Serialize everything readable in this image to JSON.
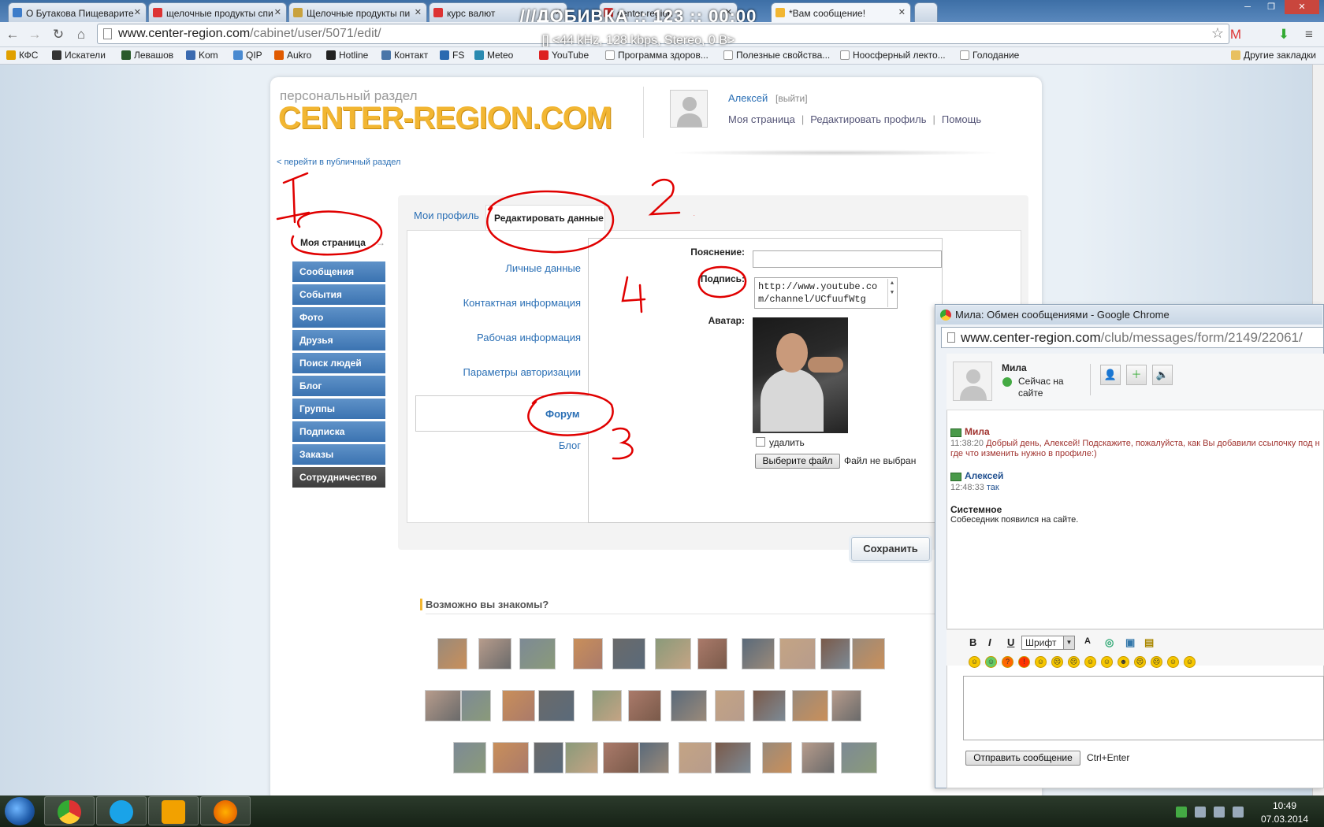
{
  "browser": {
    "tabs": [
      {
        "label": "О Бутакова Пищеварите"
      },
      {
        "label": "щелочные продукты спи"
      },
      {
        "label": "Щелочные продукты пи"
      },
      {
        "label": "курс валют"
      },
      {
        "label": "center-region"
      },
      {
        "label": "*Вам сообщение!"
      }
    ],
    "overlay_title": "///ДОБИВКА :: 123 :: 00:00",
    "overlay_sub": "[] <44 kHz, 128 kbps, Stereo, 0 B>",
    "url_host": "www.center-region.com",
    "url_path": "/cabinet/user/5071/edit/",
    "bookmarks": [
      "КФС",
      "Искатели",
      "Левашов",
      "Kom",
      "QIP",
      "Aukro",
      "Hotline",
      "Контакт",
      "FS",
      "Meteo",
      "YouTube",
      "Программа здоров...",
      "Полезные свойства...",
      "Ноосферный лекто...",
      "Голодание"
    ],
    "other_bookmarks": "Другие закладки"
  },
  "site": {
    "subtitle": "персональный раздел",
    "brand": "CENTER-REGION.COM",
    "user_name": "Алексей",
    "logout": "[выйти]",
    "nav": {
      "my_page": "Моя страница",
      "edit_profile": "Редактировать профиль",
      "help": "Помощь"
    },
    "public_link": "< перейти в публичный раздел"
  },
  "menu": {
    "my_page": "Моя страница",
    "items": [
      "Сообщения",
      "События",
      "Фото",
      "Друзья",
      "Поиск людей",
      "Блог",
      "Группы",
      "Подписка",
      "Заказы",
      "Сотрудничество"
    ]
  },
  "profile": {
    "tab_profile": "Мои профиль",
    "tab_edit": "Редактировать данные",
    "sections": [
      "Личные данные",
      "Контактная информация",
      "Рабочая информация",
      "Параметры авторизации",
      "Форум",
      "Блог"
    ],
    "labels": {
      "explanation": "Пояснение:",
      "signature": "Подпись:",
      "avatar": "Аватар:"
    },
    "explanation_value": "",
    "signature_value": "http://www.youtube.com/channel/UCfuufWtg",
    "delete_label": "удалить",
    "file_button": "Выберите файл",
    "file_none": "Файл не выбран",
    "save": "Сохранить"
  },
  "friends": {
    "title": "Возможно вы знакомы?"
  },
  "annotations": [
    "1",
    "2",
    "3",
    "4"
  ],
  "popup": {
    "title": "Мила: Обмен сообщениями - Google Chrome",
    "url_host": "www.center-region.com",
    "url_path": "/club/messages/form/2149/22061/",
    "contact_name": "Мила",
    "status": "Сейчас на сайте",
    "messages": [
      {
        "author": "Мила",
        "time": "11:38:20",
        "text1": "Добрый день, Алексей! Подскажите, пожалуйста, как Вы добавили ссылочку под н",
        "text2": "где что изменить нужно в профиле:)"
      },
      {
        "author": "Алексей",
        "time": "12:48:33",
        "text1": "так"
      },
      {
        "author": "Системное",
        "text1": "Собеседник появился на сайте."
      }
    ],
    "toolbar": {
      "bold": "B",
      "italic": "I",
      "underline": "U",
      "font": "Шрифт"
    },
    "send": "Отправить сообщение",
    "send_hint": "Ctrl+Enter"
  },
  "clock": {
    "time": "10:49",
    "date": "07.03.2014"
  },
  "colors": {
    "brand": "#f2b632",
    "menu": "#3b73b1",
    "link": "#2a6fb5",
    "annotation": "#e00000"
  }
}
